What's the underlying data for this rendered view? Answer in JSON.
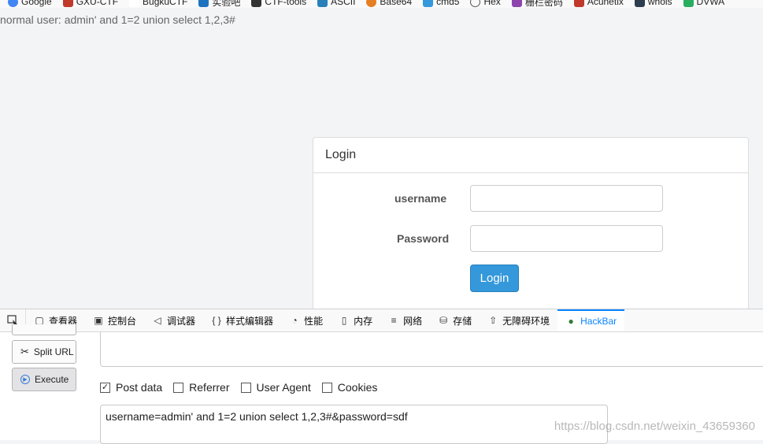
{
  "bookmarks": [
    {
      "label": "Google",
      "icon": "google-icon",
      "color": "#4285f4"
    },
    {
      "label": "GXU-CTF",
      "icon": "gxu-icon",
      "color": "#c0392b"
    },
    {
      "label": "BugkuCTF",
      "icon": "bugku-icon",
      "color": "#ffffff"
    },
    {
      "label": "实验吧",
      "icon": "shiyanba-icon",
      "color": "#1e73be"
    },
    {
      "label": "CTF-tools",
      "icon": "ctf-tools-icon",
      "color": "#333333"
    },
    {
      "label": "ASCII",
      "icon": "ascii-icon",
      "color": "#2980b9"
    },
    {
      "label": "Base64",
      "icon": "base64-icon",
      "color": "#e67e22"
    },
    {
      "label": "cmd5",
      "icon": "cmd5-icon",
      "color": "#3498db"
    },
    {
      "label": "Hex",
      "icon": "globe-icon",
      "color": "#555555"
    },
    {
      "label": "栅栏密码",
      "icon": "fence-icon",
      "color": "#8e44ad"
    },
    {
      "label": "Acunetix",
      "icon": "acunetix-icon",
      "color": "#c0392b"
    },
    {
      "label": "whois",
      "icon": "whois-icon",
      "color": "#2c3e50"
    },
    {
      "label": "DVWA",
      "icon": "dvwa-icon",
      "color": "#27ae60"
    }
  ],
  "result_text": "normal user: admin' and 1=2 union select 1,2,3#",
  "login_panel": {
    "heading": "Login",
    "username_label": "username",
    "password_label": "Password",
    "username_value": "",
    "password_value": "",
    "submit_label": "Login"
  },
  "devtools": {
    "tabs": [
      {
        "label": "查看器",
        "icon": "inspector-icon",
        "glyph": "▢"
      },
      {
        "label": "控制台",
        "icon": "console-icon",
        "glyph": "▣"
      },
      {
        "label": "调试器",
        "icon": "debugger-icon",
        "glyph": "◁"
      },
      {
        "label": "样式编辑器",
        "icon": "style-editor-icon",
        "glyph": "{ }"
      },
      {
        "label": "性能",
        "icon": "performance-icon",
        "glyph": "◔"
      },
      {
        "label": "内存",
        "icon": "memory-icon",
        "glyph": "▯"
      },
      {
        "label": "网络",
        "icon": "network-icon",
        "glyph": "≡"
      },
      {
        "label": "存储",
        "icon": "storage-icon",
        "glyph": "⛁"
      },
      {
        "label": "无障碍环境",
        "icon": "accessibility-icon",
        "glyph": "⇧"
      },
      {
        "label": "HackBar",
        "icon": "hackbar-icon",
        "glyph": "●"
      }
    ],
    "active_tab": "HackBar"
  },
  "hackbar": {
    "split_url_label": "Split URL",
    "execute_label": "Execute",
    "url_value": "",
    "options": [
      {
        "label": "Post data",
        "checked": true
      },
      {
        "label": "Referrer",
        "checked": false
      },
      {
        "label": "User Agent",
        "checked": false
      },
      {
        "label": "Cookies",
        "checked": false
      }
    ],
    "post_data": "username=admin' and 1=2 union select 1,2,3#&password=sdf"
  },
  "watermark": "https://blog.csdn.net/weixin_43659360",
  "colors": {
    "primary_button": "#3498db",
    "active_tab": "#0a84ff",
    "page_background": "#f3f4f6"
  }
}
